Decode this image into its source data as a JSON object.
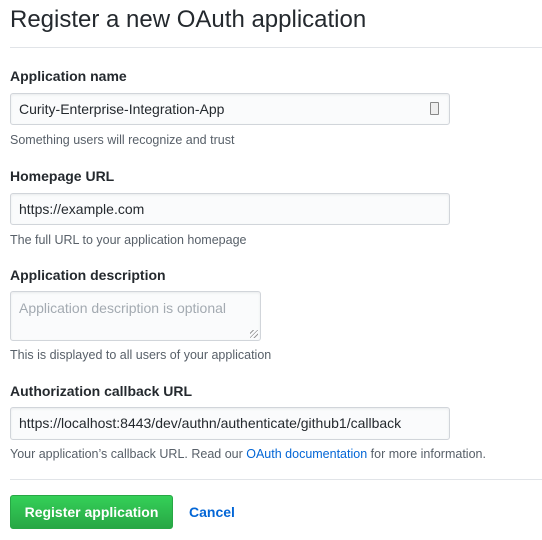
{
  "page": {
    "title": "Register a new OAuth application"
  },
  "fields": {
    "name": {
      "label": "Application name",
      "value": "Curity-Enterprise-Integration-App",
      "help": "Something users will recognize and trust"
    },
    "homepage": {
      "label": "Homepage URL",
      "value": "https://example.com",
      "help": "The full URL to your application homepage"
    },
    "description": {
      "label": "Application description",
      "placeholder": "Application description is optional",
      "help": "This is displayed to all users of your application"
    },
    "callback": {
      "label": "Authorization callback URL",
      "value": "https://localhost:8443/dev/authn/authenticate/github1/callback",
      "help_before": "Your application’s callback URL. Read our ",
      "help_link": "OAuth documentation",
      "help_after": " for more information."
    }
  },
  "actions": {
    "register": "Register application",
    "cancel": "Cancel"
  },
  "colors": {
    "primary": "#28a745",
    "link": "#0366d6"
  }
}
